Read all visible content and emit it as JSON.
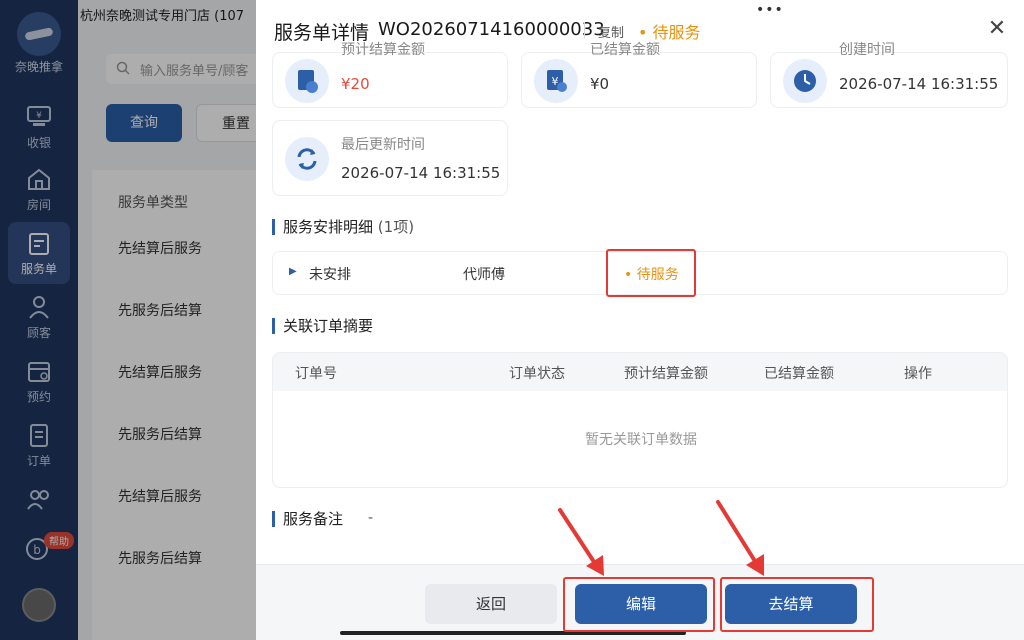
{
  "sidebar": {
    "logo_text": "奈晚推拿",
    "items": [
      {
        "label": "收银",
        "icon": "cashier-icon"
      },
      {
        "label": "房间",
        "icon": "room-icon"
      },
      {
        "label": "服务单",
        "icon": "service-order-icon"
      },
      {
        "label": "顾客",
        "icon": "customer-icon"
      },
      {
        "label": "预约",
        "icon": "calendar-icon"
      },
      {
        "label": "订单",
        "icon": "order-icon"
      },
      {
        "label": "",
        "icon": "staff-icon"
      }
    ],
    "help_badge": "帮助"
  },
  "background_page": {
    "store_header": "杭州奈晚测试专用门店 (107",
    "search_placeholder": "输入服务单号/顾客",
    "query_button": "查询",
    "reset_button": "重置",
    "column_header": "服务单类型",
    "rows": [
      "先结算后服务",
      "先服务后结算",
      "先结算后服务",
      "先服务后结算",
      "先结算后服务",
      "先服务后结算"
    ]
  },
  "drawer": {
    "title": "服务单详情",
    "order_no": "WO20260714160000033",
    "copy_label": "复制",
    "status": "• 待服务",
    "stats": [
      {
        "label": "预计结算金额",
        "value": "¥20",
        "icon": "bill-icon"
      },
      {
        "label": "已结算金额",
        "value": "¥0",
        "icon": "yen-check-icon"
      },
      {
        "label": "创建时间",
        "value": "2026-07-14 16:31:55",
        "icon": "clock-icon"
      },
      {
        "label": "最后更新时间",
        "value": "2026-07-14 16:31:55",
        "icon": "refresh-icon"
      }
    ],
    "arrangement": {
      "title": "服务安排明细",
      "count": "(1项)",
      "row": {
        "state": "未安排",
        "master": "代师傅",
        "status": "• 待服务"
      }
    },
    "linked_orders": {
      "title": "关联订单摘要",
      "columns": [
        "订单号",
        "订单状态",
        "预计结算金额",
        "已结算金额",
        "操作"
      ],
      "empty_text": "暂无关联订单数据"
    },
    "remark": {
      "title": "服务备注",
      "value": "-"
    },
    "footer": {
      "back": "返回",
      "edit": "编辑",
      "settle": "去结算"
    }
  },
  "colors": {
    "primary": "#2c5fa8",
    "status_orange": "#e8920f",
    "highlight_red": "#e53935",
    "sidebar_bg": "#1f3660"
  }
}
